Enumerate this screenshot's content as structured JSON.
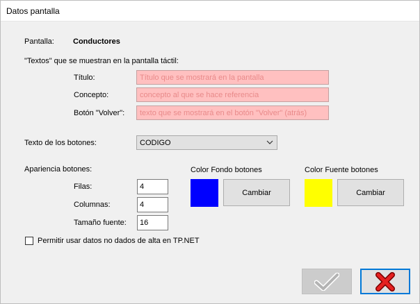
{
  "window": {
    "title": "Datos pantalla"
  },
  "pantalla": {
    "label": "Pantalla:",
    "value": "Conductores"
  },
  "textos": {
    "heading": "\"Textos\" que se muestran en la pantalla táctil:",
    "titulo": {
      "label": "Título:",
      "placeholder": "Título que se mostrará en la pantalla"
    },
    "concepto": {
      "label": "Concepto:",
      "placeholder": "concepto al que se hace referencia"
    },
    "volver": {
      "label": "Botón \"Volver\":",
      "placeholder": "texto que se mostrará en el botón \"Volver\" (atrás)"
    }
  },
  "texto_botones": {
    "label": "Texto de los botones:",
    "selected": "CODIGO"
  },
  "apariencia": {
    "heading": "Apariencia botones:",
    "filas": {
      "label": "Filas:",
      "value": "4"
    },
    "columnas": {
      "label": "Columnas:",
      "value": "4"
    },
    "tamano_fuente": {
      "label": "Tamaño fuente:",
      "value": "16"
    }
  },
  "color_fondo": {
    "label": "Color Fondo botones",
    "color": "#0000ff",
    "button": "Cambiar"
  },
  "color_fuente": {
    "label": "Color Fuente botones",
    "color": "#ffff00",
    "button": "Cambiar"
  },
  "permitir": {
    "label": "Permitir usar datos no dados de alta en TP.NET",
    "checked": false
  },
  "icons": {
    "ok": "checkmark-icon",
    "cancel": "close-icon"
  }
}
